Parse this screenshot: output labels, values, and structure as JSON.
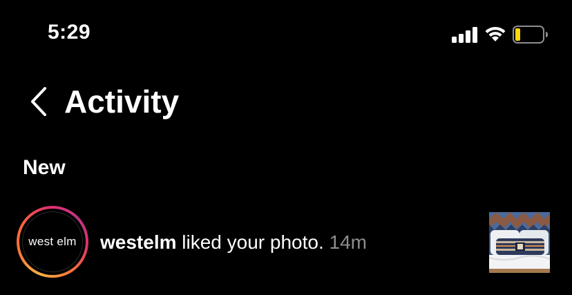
{
  "status_bar": {
    "time": "5:29",
    "icons": [
      "signal-icon",
      "wifi-icon",
      "battery-icon"
    ],
    "battery_color": "#ffd60a"
  },
  "header": {
    "back_icon": "chevron-left-icon",
    "title": "Activity"
  },
  "sections": [
    {
      "heading": "New",
      "items": [
        {
          "avatar_text": "west elm",
          "username": "westelm",
          "action": " liked your photo.",
          "time": " 14m",
          "thumbnail": "liked-photo-thumbnail"
        }
      ]
    }
  ],
  "colors": {
    "background": "#000000",
    "text": "#ffffff",
    "secondary_text": "#8e8e8e"
  }
}
